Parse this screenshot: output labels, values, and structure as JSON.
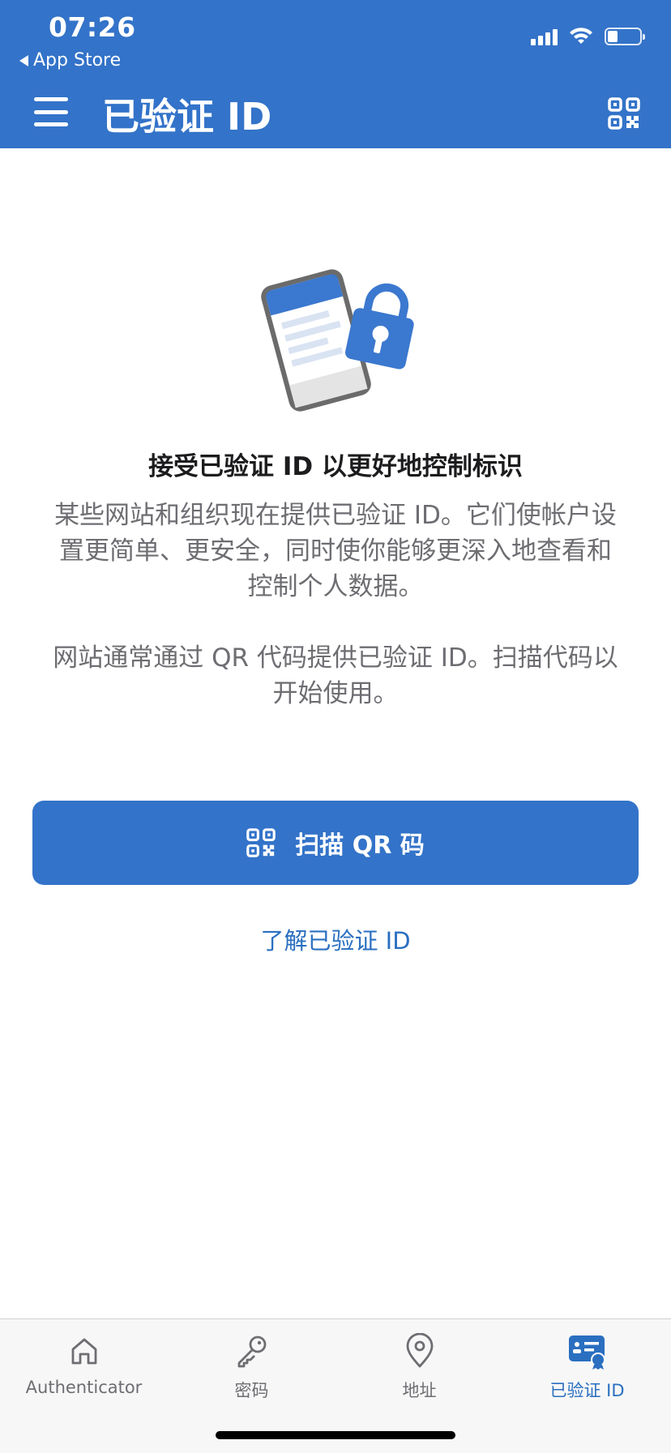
{
  "status_bar": {
    "time": "07:26",
    "back_app": "App Store"
  },
  "header": {
    "title": "已验证 ID",
    "menu_icon": "hamburger-menu-icon",
    "qr_icon": "qr-code-icon"
  },
  "main": {
    "illustration_icon": "phone-with-lock-icon",
    "headline": "接受已验证 ID 以更好地控制标识",
    "paragraph_1": "某些网站和组织现在提供已验证 ID。它们使帐户设置更简单、更安全，同时使你能够更深入地查看和控制个人数据。",
    "paragraph_2": "网站通常通过 QR 代码提供已验证 ID。扫描代码以开始使用。",
    "scan_button_label": "扫描 QR 码",
    "learn_link": "了解已验证 ID"
  },
  "tabbar": {
    "active": "verified-id",
    "tabs": [
      {
        "id": "authenticator",
        "label": "Authenticator",
        "icon": "home-icon"
      },
      {
        "id": "passwords",
        "label": "密码",
        "icon": "key-icon"
      },
      {
        "id": "addresses",
        "label": "地址",
        "icon": "location-pin-icon"
      },
      {
        "id": "verified-id",
        "label": "已验证 ID",
        "icon": "id-card-badge-icon"
      }
    ]
  },
  "colors": {
    "brand_blue": "#3373c9",
    "link_blue": "#2a6fc0",
    "tab_inactive": "#6d6d72"
  }
}
